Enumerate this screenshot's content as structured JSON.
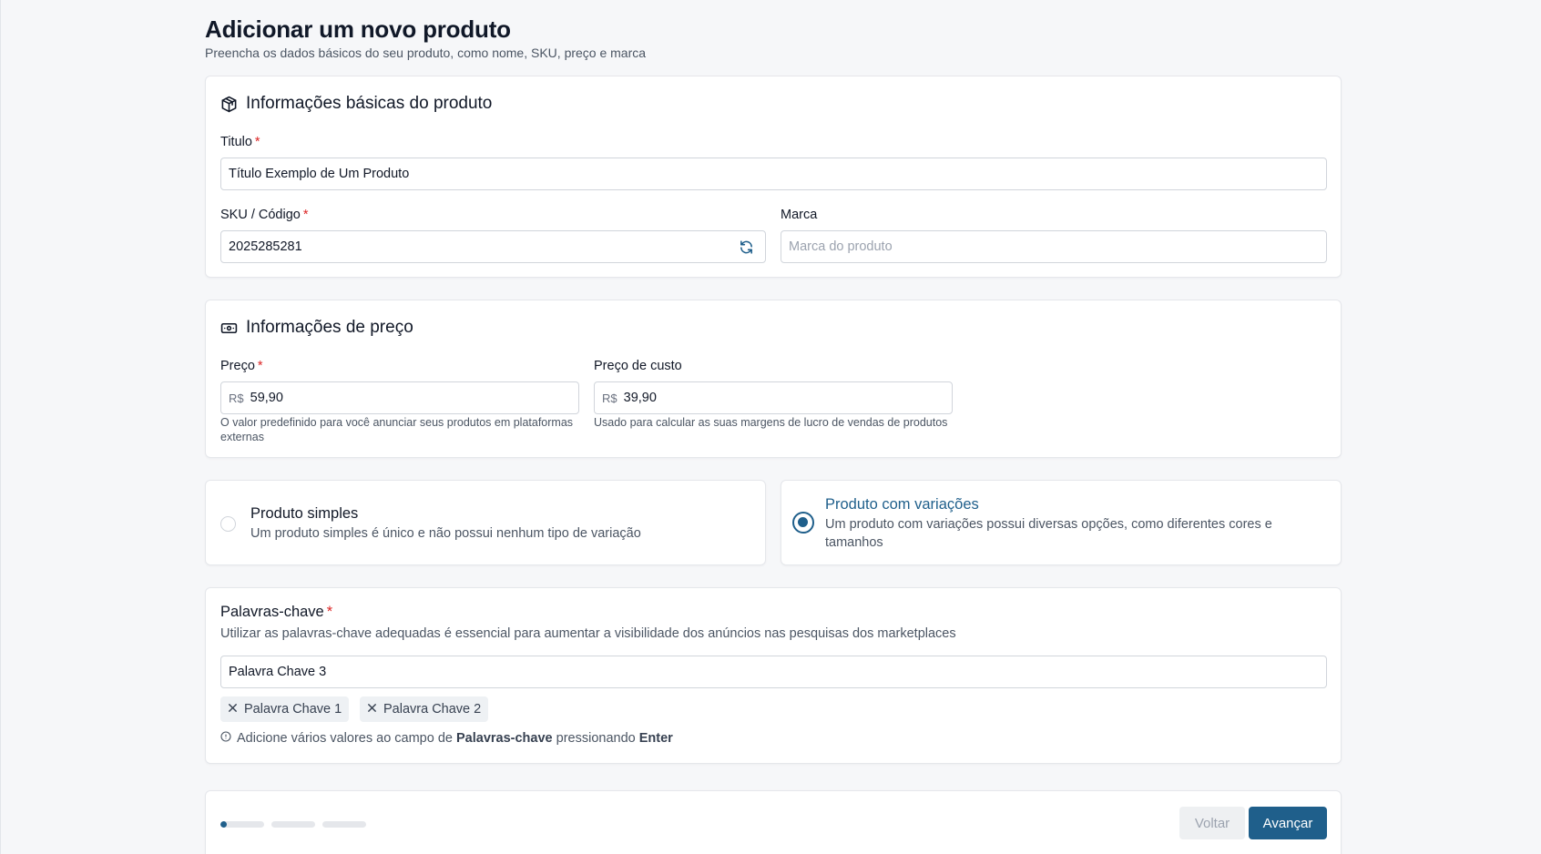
{
  "header": {
    "title": "Adicionar um novo produto",
    "subtitle": "Preencha os dados básicos do seu produto, como nome, SKU, preço e marca"
  },
  "basic_info": {
    "section_title": "Informações básicas do produto",
    "section_icon": "package-icon",
    "title_label": "Titulo",
    "title_value": "Título Exemplo de Um Produto",
    "sku_label": "SKU / Código",
    "sku_value": "2025285281",
    "sku_icon": "refresh-icon",
    "brand_label": "Marca",
    "brand_placeholder": "Marca do produto",
    "required_mark": "*"
  },
  "pricing": {
    "section_title": "Informações de preço",
    "section_icon": "banknote-icon",
    "price_label": "Preço",
    "price_prefix": "R$",
    "price_value": "59,90",
    "price_help": "O valor predefinido para você anunciar seus produtos em plataformas externas",
    "cost_label": "Preço de custo",
    "cost_prefix": "R$",
    "cost_value": "39,90",
    "cost_help": "Usado para calcular as suas margens de lucro de vendas de produtos"
  },
  "product_type": {
    "selected": "variations",
    "simple": {
      "title": "Produto simples",
      "description": "Um produto simples é único e não possui nenhum tipo de variação"
    },
    "variations": {
      "title": "Produto com variações",
      "description": "Um produto com variações possui diversas opções, como diferentes cores e tamanhos"
    }
  },
  "keywords": {
    "label": "Palavras-chave",
    "description": "Utilizar as palavras-chave adequadas é essencial para aumentar a visibilidade dos anúncios nas pesquisas dos marketplaces",
    "input_value": "Palavra Chave 3",
    "chips": [
      "Palavra Chave 1",
      "Palavra Chave 2"
    ],
    "hint_prefix": "Adicione vários valores ao campo de",
    "hint_field": "Palavras-chave",
    "hint_middle": "pressionando",
    "hint_key": "Enter"
  },
  "footer": {
    "steps_total": 3,
    "current_step": 1,
    "current_step_progress": 0.15,
    "back_label": "Voltar",
    "next_label": "Avançar"
  },
  "colors": {
    "accent": "#1f5f8b",
    "required": "#dc2626",
    "background": "#f6f7f9"
  }
}
